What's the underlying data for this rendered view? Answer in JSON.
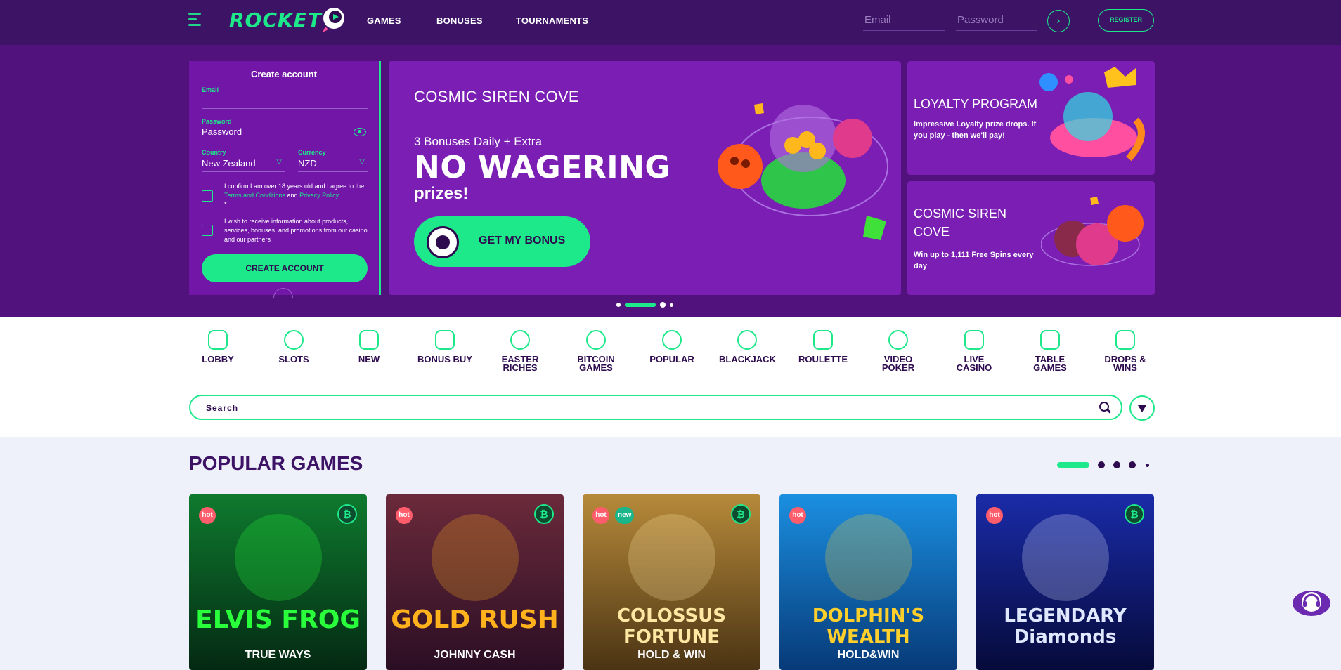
{
  "header": {
    "brand": "ROCKET",
    "nav": [
      "GAMES",
      "BONUSES",
      "TOURNAMENTS"
    ],
    "email_placeholder": "Email",
    "password_placeholder": "Password",
    "register_label": "REGISTER",
    "go_icon": "arrow-right-icon"
  },
  "signup": {
    "title": "Create account",
    "email_label": "Email",
    "email_value": "",
    "password_label": "Password",
    "password_placeholder": "Password",
    "country_label": "Country",
    "country_value": "New Zealand",
    "currency_label": "Currency",
    "currency_value": "NZD",
    "age_text_1": "I confirm I am over 18 years old and I agree to the ",
    "terms_link": "Terms and Conditions",
    "age_text_2": " and ",
    "privacy_link": "Privacy Policy",
    "age_required": "*",
    "marketing_text": "I wish to receive information about products, services, bonuses, and promotions from our casino and our partners",
    "create_button": "CREATE ACCOUNT"
  },
  "banner": {
    "title": "COSMIC SIREN COVE",
    "line1": "3 Bonuses Daily + Extra",
    "headline": "NO WAGERING",
    "line2": "prizes!",
    "cta": "GET MY BONUS"
  },
  "side_cards": [
    {
      "title": "LOYALTY PROGRAM",
      "desc": "Impressive Loyalty prize drops. If you play - then we'll pay!"
    },
    {
      "title": "COSMIC SIREN COVE",
      "desc": "Win up to 1,111 Free Spins every day"
    }
  ],
  "hero_slider": {
    "slides": 4,
    "active_index": 1
  },
  "categories": [
    {
      "label": "LOBBY",
      "icon": "lobby-icon"
    },
    {
      "label": "SLOTS",
      "icon": "slots-seven-icon"
    },
    {
      "label": "NEW",
      "icon": "new-icon"
    },
    {
      "label": "BONUS BUY",
      "icon": "bonus-buy-icon"
    },
    {
      "label": "EASTER RICHES",
      "icon": "easter-egg-icon"
    },
    {
      "label": "BITCOIN GAMES",
      "icon": "bitcoin-icon"
    },
    {
      "label": "POPULAR",
      "icon": "flame-icon"
    },
    {
      "label": "BLACKJACK",
      "icon": "club-icon"
    },
    {
      "label": "ROULETTE",
      "icon": "roulette-icon"
    },
    {
      "label": "VIDEO POKER",
      "icon": "play-icon"
    },
    {
      "label": "LIVE CASINO",
      "icon": "live-casino-icon"
    },
    {
      "label": "TABLE GAMES",
      "icon": "table-games-icon"
    },
    {
      "label": "DROPS & WINS",
      "icon": "drops-wins-icon"
    }
  ],
  "search": {
    "placeholder": "Search"
  },
  "popular": {
    "title": "POPULAR GAMES",
    "games": [
      {
        "name": "ELVIS FROG",
        "sub": "TRUE WAYS",
        "badges": [
          "hot"
        ],
        "btc": "₿",
        "bg": "#0e7a2e",
        "bg2": "#042913",
        "title_color": "#29ff3b"
      },
      {
        "name": "GOLD RUSH",
        "sub": "JOHNNY CASH",
        "badges": [
          "hot"
        ],
        "btc": "₿",
        "bg": "#6b2a3b",
        "bg2": "#2b0e24",
        "title_color": "#ffb21c"
      },
      {
        "name": "COLOSSUS FORTUNE",
        "sub": "HOLD & WIN",
        "badges": [
          "hot",
          "new"
        ],
        "btc": "₿",
        "bg": "#b78a3a",
        "bg2": "#4b3414",
        "title_color": "#ffe8a3"
      },
      {
        "name": "DOLPHIN'S WEALTH",
        "sub": "HOLD&WIN",
        "badges": [
          "hot"
        ],
        "btc": "",
        "bg": "#1b8fe0",
        "bg2": "#073a78",
        "title_color": "#ffcf2b"
      },
      {
        "name": "LEGENDARY Diamonds",
        "sub": "",
        "badges": [
          "hot"
        ],
        "btc": "₿",
        "bg": "#1a2ba8",
        "bg2": "#060a3a",
        "title_color": "#dfe8ff"
      }
    ]
  },
  "colors": {
    "accent": "#1de88a",
    "header": "#3d1366",
    "hero": "#51127d",
    "card": "#7b1eb3",
    "hot": "#ff5d6c"
  }
}
